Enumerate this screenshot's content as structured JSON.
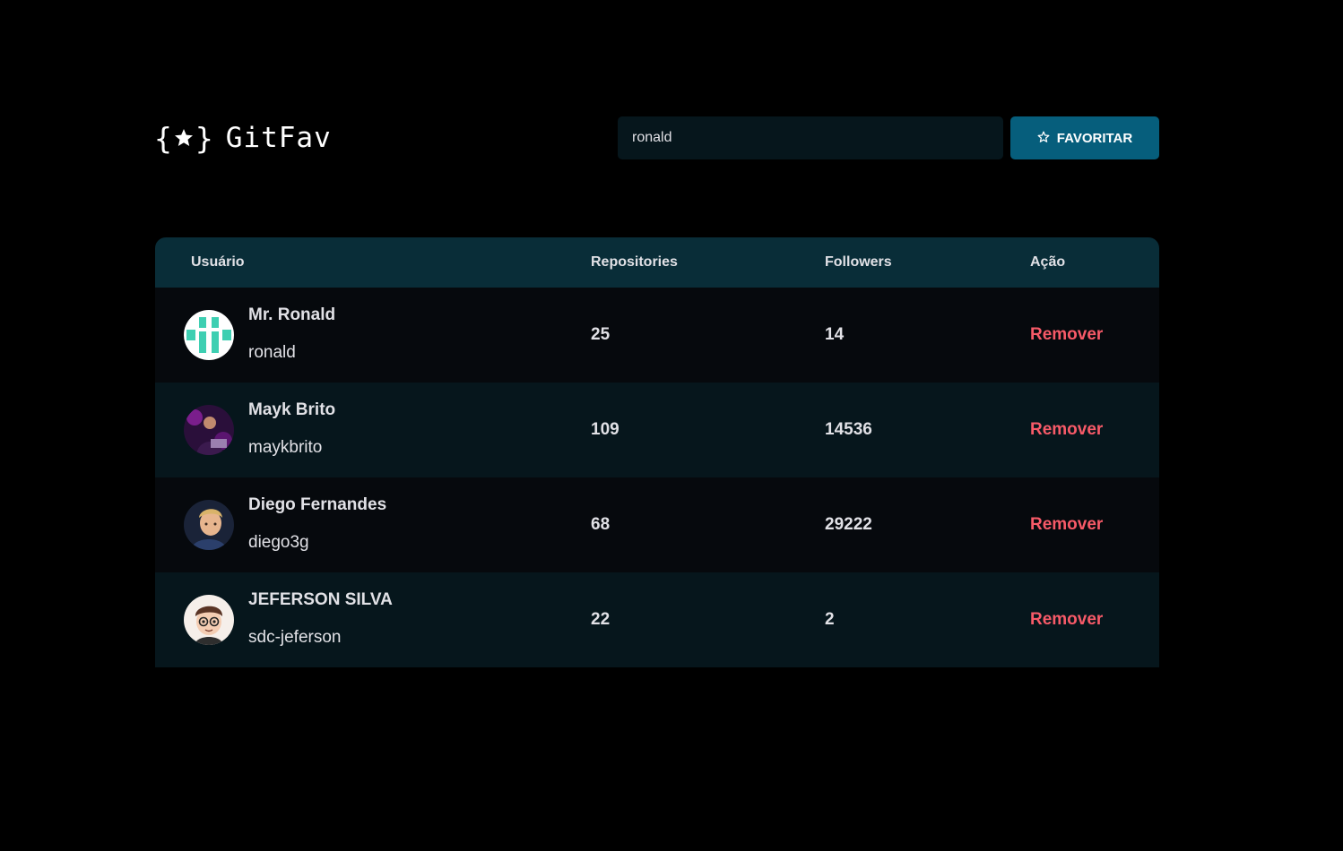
{
  "header": {
    "logo_text": "GitFav",
    "search": {
      "value": "ronald"
    },
    "favorite_button_label": "FAVORITAR"
  },
  "table": {
    "columns": [
      "Usuário",
      "Repositories",
      "Followers",
      "Ação"
    ],
    "rows": [
      {
        "name": "Mr. Ronald",
        "login": "ronald",
        "repositories": "25",
        "followers": "14",
        "action": "Remover"
      },
      {
        "name": "Mayk Brito",
        "login": "maykbrito",
        "repositories": "109",
        "followers": "14536",
        "action": "Remover"
      },
      {
        "name": "Diego Fernandes",
        "login": "diego3g",
        "repositories": "68",
        "followers": "29222",
        "action": "Remover"
      },
      {
        "name": "JEFERSON SILVA",
        "login": "sdc-jeferson",
        "repositories": "22",
        "followers": "2",
        "action": "Remover"
      }
    ]
  },
  "colors": {
    "background": "#000000",
    "header_row": "#092D38",
    "row_dark": "#06090D",
    "row_light": "#06161C",
    "button": "#065E7C",
    "remove_text": "#F75A68",
    "text": "#E1E1E6"
  },
  "icons": {
    "logo": "braces-star-icon",
    "button": "star-outline-icon"
  }
}
